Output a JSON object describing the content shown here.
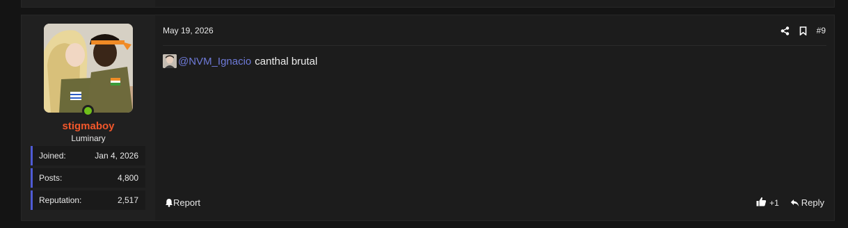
{
  "post": {
    "date": "May 19, 2026",
    "number": "#9",
    "mention": "@NVM_Ignacio",
    "body": "canthal brutal",
    "like_count": "+1",
    "report_label": "Report",
    "reply_label": "Reply"
  },
  "user": {
    "name": "stigmaboy",
    "title": "Luminary",
    "online": true,
    "stats": [
      {
        "label": "Joined:",
        "value": "Jan 4, 2026"
      },
      {
        "label": "Posts:",
        "value": "4,800"
      },
      {
        "label": "Reputation:",
        "value": "2,517"
      }
    ]
  },
  "icons": {
    "share": "share-icon",
    "bookmark": "bookmark-icon",
    "bell": "bell-icon",
    "like": "thumbs-up-icon",
    "reply": "reply-arrow-icon"
  },
  "colors": {
    "username": "#f1572b",
    "mention": "#6e7ad8",
    "online": "#6fbf1a",
    "stat_accent": "#4f5bd5"
  }
}
